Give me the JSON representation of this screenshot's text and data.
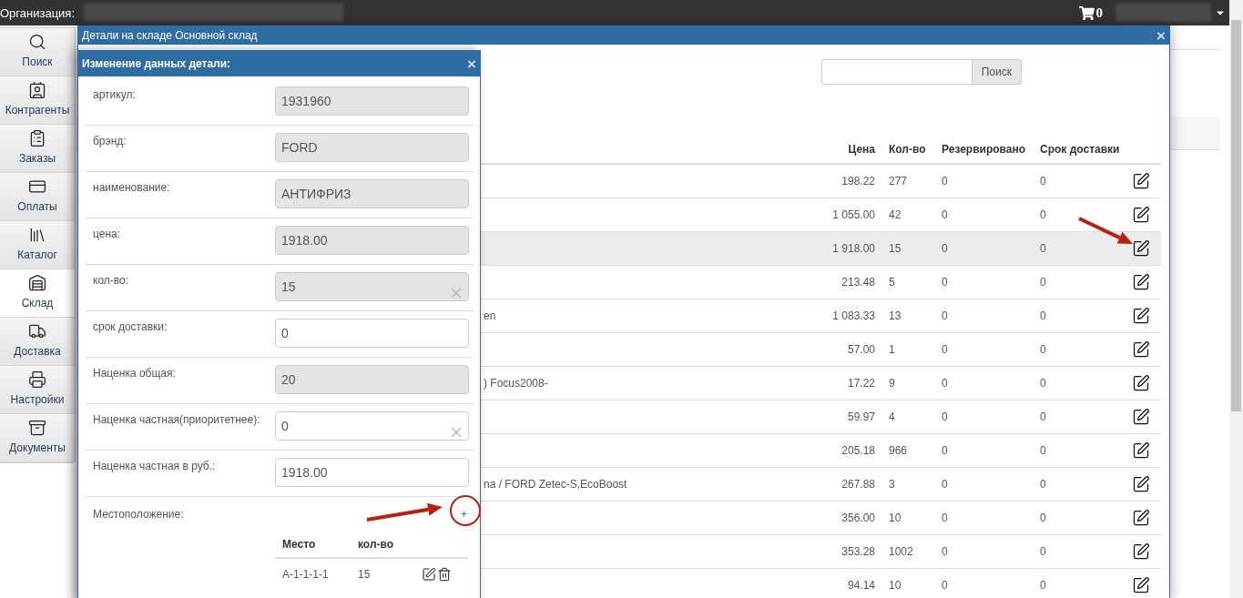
{
  "top_bar": {
    "org_label": "Организация:",
    "cart_count": "0"
  },
  "sidebar": {
    "items": [
      {
        "label": "Поиск",
        "selected": false
      },
      {
        "label": "Контрагенты",
        "selected": false
      },
      {
        "label": "Заказы",
        "selected": false
      },
      {
        "label": "Оплаты",
        "selected": false
      },
      {
        "label": "Каталог",
        "selected": false
      },
      {
        "label": "Склад",
        "selected": true
      },
      {
        "label": "Доставка",
        "selected": false
      },
      {
        "label": "Настройки",
        "selected": false
      },
      {
        "label": "Документы",
        "selected": false
      }
    ]
  },
  "stock_dialog": {
    "title": "Детали на складе Основной склад",
    "close": "×",
    "search_button": "Поиск",
    "columns": [
      "Цена",
      "Кол-во",
      "Резервировано",
      "Срок доставки"
    ],
    "rows": [
      {
        "price": "198.22",
        "qty": "277",
        "reserved": "0",
        "delivery": "0",
        "highlighted": false
      },
      {
        "price": "1 055.00",
        "qty": "42",
        "reserved": "0",
        "delivery": "0",
        "highlighted": false
      },
      {
        "price": "1 918.00",
        "qty": "15",
        "reserved": "0",
        "delivery": "0",
        "highlighted": true
      },
      {
        "price": "213.48",
        "qty": "5",
        "reserved": "0",
        "delivery": "0",
        "highlighted": false
      },
      {
        "name": "en",
        "price": "1 083.33",
        "qty": "13",
        "reserved": "0",
        "delivery": "0",
        "highlighted": false
      },
      {
        "price": "57.00",
        "qty": "1",
        "reserved": "0",
        "delivery": "0",
        "highlighted": false
      },
      {
        "name": ") Focus2008-",
        "price": "17.22",
        "qty": "9",
        "reserved": "0",
        "delivery": "0",
        "highlighted": false
      },
      {
        "price": "59.97",
        "qty": "4",
        "reserved": "0",
        "delivery": "0",
        "highlighted": false
      },
      {
        "price": "205.18",
        "qty": "966",
        "reserved": "0",
        "delivery": "0",
        "highlighted": false
      },
      {
        "name": "na / FORD Zetec-S,EcoBoost",
        "price": "267.88",
        "qty": "3",
        "reserved": "0",
        "delivery": "0",
        "highlighted": false
      },
      {
        "price": "356.00",
        "qty": "10",
        "reserved": "0",
        "delivery": "0",
        "highlighted": false
      },
      {
        "price": "353.28",
        "qty": "1002",
        "reserved": "0",
        "delivery": "0",
        "highlighted": false
      },
      {
        "price": "94.14",
        "qty": "10",
        "reserved": "0",
        "delivery": "0",
        "highlighted": false
      }
    ]
  },
  "edit_dialog": {
    "title": "Изменение данных детали:",
    "close": "×",
    "fields": [
      {
        "label": "артикул:",
        "value": "1931960",
        "disabled": true,
        "clearable": false
      },
      {
        "label": "брэнд:",
        "value": "FORD",
        "disabled": true,
        "clearable": false
      },
      {
        "label": "наименование:",
        "value": "АНТИФРИЗ",
        "disabled": true,
        "clearable": false
      },
      {
        "label": "цена:",
        "value": "1918.00",
        "disabled": true,
        "clearable": false
      },
      {
        "label": "кол-во:",
        "value": "15",
        "disabled": true,
        "clearable": true
      },
      {
        "label": "срок доставки:",
        "value": "0",
        "disabled": false,
        "clearable": false
      },
      {
        "label": "Наценка общая:",
        "value": "20",
        "disabled": true,
        "clearable": false
      },
      {
        "label": "Наценка частная(приоритетнее):",
        "value": "0",
        "disabled": false,
        "clearable": true
      },
      {
        "label": "Наценка частная в руб.:",
        "value": "1918.00",
        "disabled": false,
        "clearable": false
      }
    ],
    "location": {
      "label": "Местоположение:",
      "add": "+",
      "columns": [
        "Место",
        "кол-во"
      ],
      "rows": [
        {
          "place": "A-1-1-1-1",
          "qty": "15"
        }
      ]
    }
  }
}
